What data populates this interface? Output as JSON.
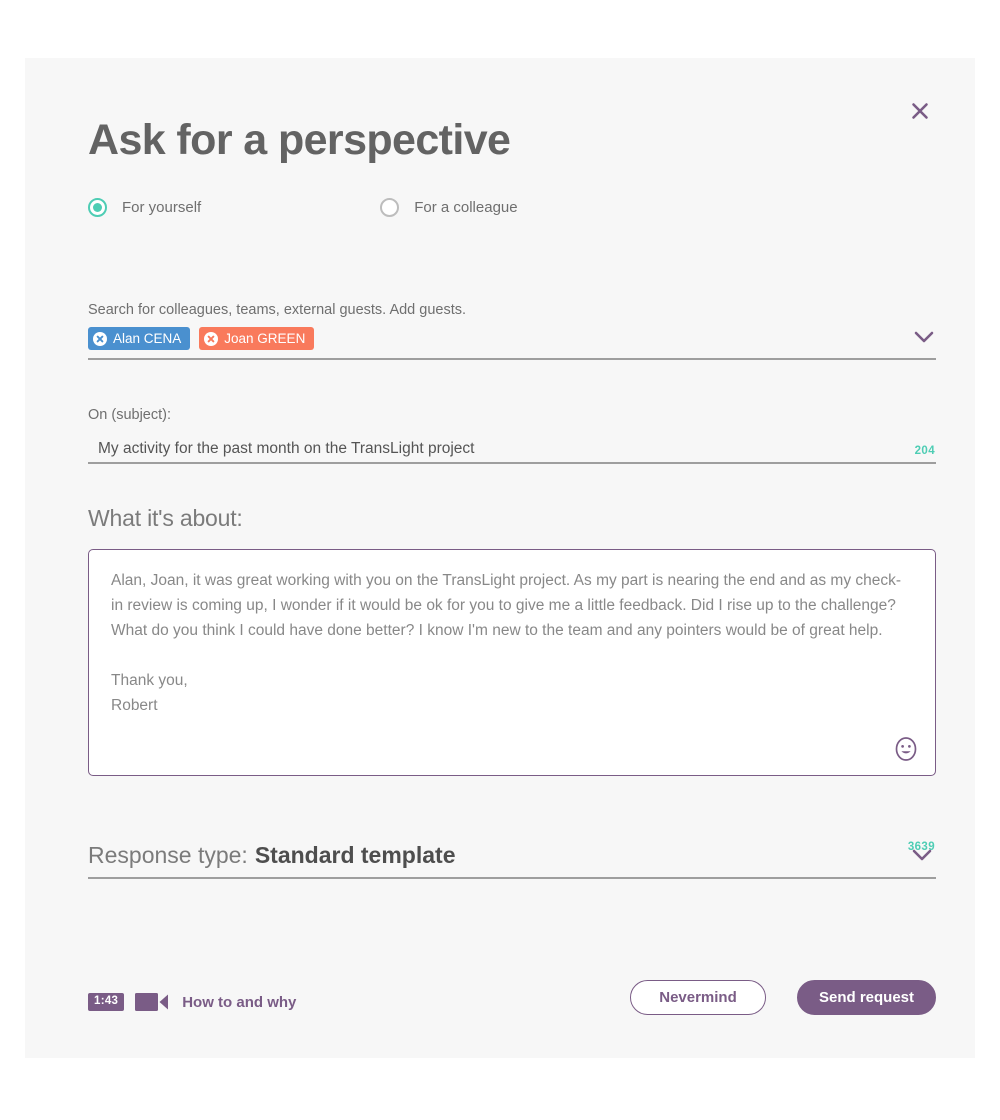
{
  "dialog": {
    "title": "Ask for a perspective",
    "close_icon": "close-icon"
  },
  "audience": {
    "options": [
      {
        "label": "For yourself",
        "selected": true
      },
      {
        "label": "For a colleague",
        "selected": false
      }
    ]
  },
  "recipients": {
    "label": "Search for colleagues, teams, external guests. Add guests.",
    "tags": [
      {
        "name": "Alan CENA",
        "color": "#4a90cf"
      },
      {
        "name": "Joan GREEN",
        "color": "#f97a5c"
      }
    ],
    "caret_icon": "chevron-down-icon"
  },
  "subject": {
    "label": "On (subject):",
    "value": "My activity for the past month on the TransLight project",
    "remaining": "204"
  },
  "body": {
    "heading": "What it's about:",
    "text": "Alan, Joan, it was great working with you on the TransLight project. As my part is nearing the end and as my check-in review is coming up, I wonder if it would be ok for you to give me a little feedback. Did I rise up to the challenge? What do you think I could have done better? I know I'm new to the team and any pointers would be of great help.\n\nThank you,\nRobert",
    "remaining": "3639",
    "emoji_icon": "emoji-smiley-icon"
  },
  "response_type": {
    "label": "Response type:",
    "value": "Standard template",
    "caret_icon": "chevron-down-icon"
  },
  "help": {
    "duration": "1:43",
    "video_icon": "video-camera-icon",
    "text": "How to and why"
  },
  "actions": {
    "cancel_label": "Nevermind",
    "submit_label": "Send request"
  },
  "colors": {
    "accent_purple": "#7a5c86",
    "accent_teal": "#4ecdb4",
    "tag_blue": "#4a90cf",
    "tag_orange": "#f97a5c",
    "card_bg": "#f7f7f7"
  }
}
